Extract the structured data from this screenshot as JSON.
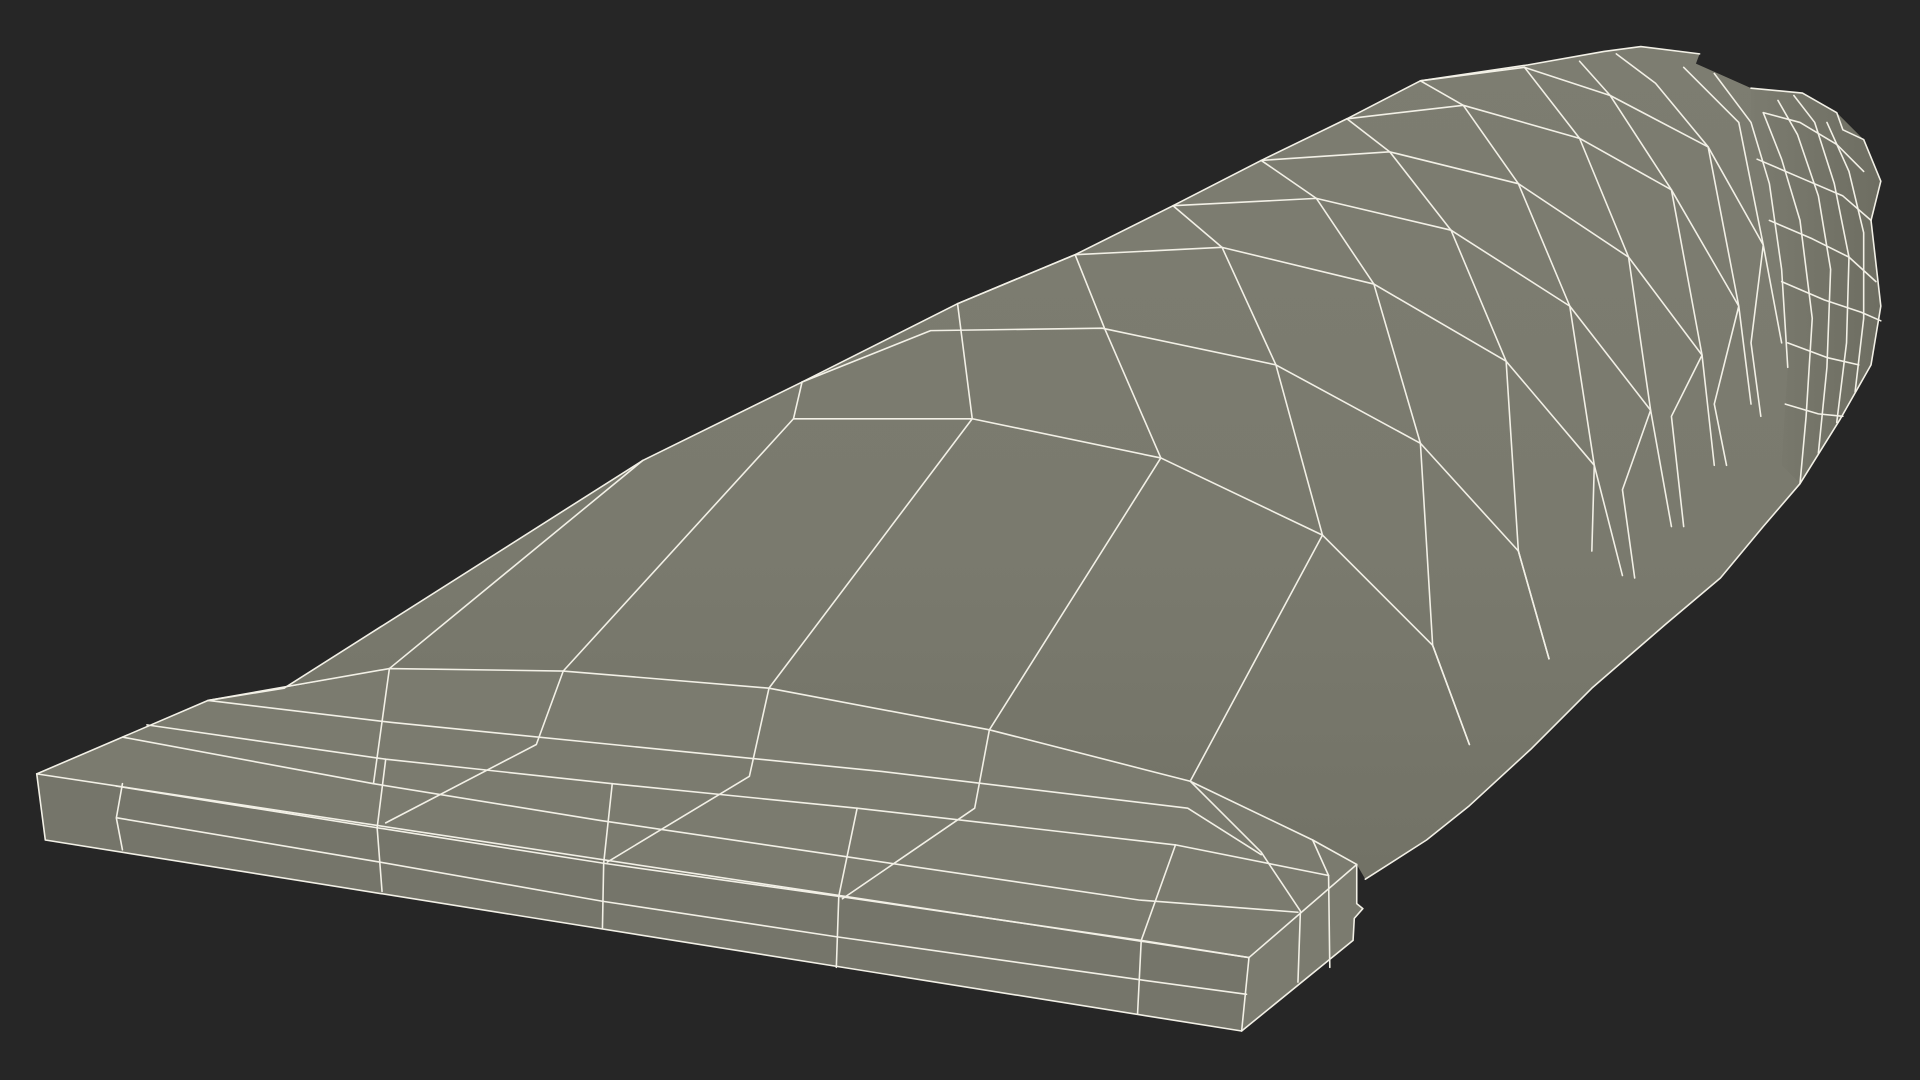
{
  "scene": {
    "subject": "tube-wireframe-model",
    "colors": {
      "background": "#262626",
      "surface": "#7b7b6f",
      "surface_shadow": "#727266",
      "surface_light": "#838377",
      "wireframe": "#f2f0e6"
    }
  }
}
